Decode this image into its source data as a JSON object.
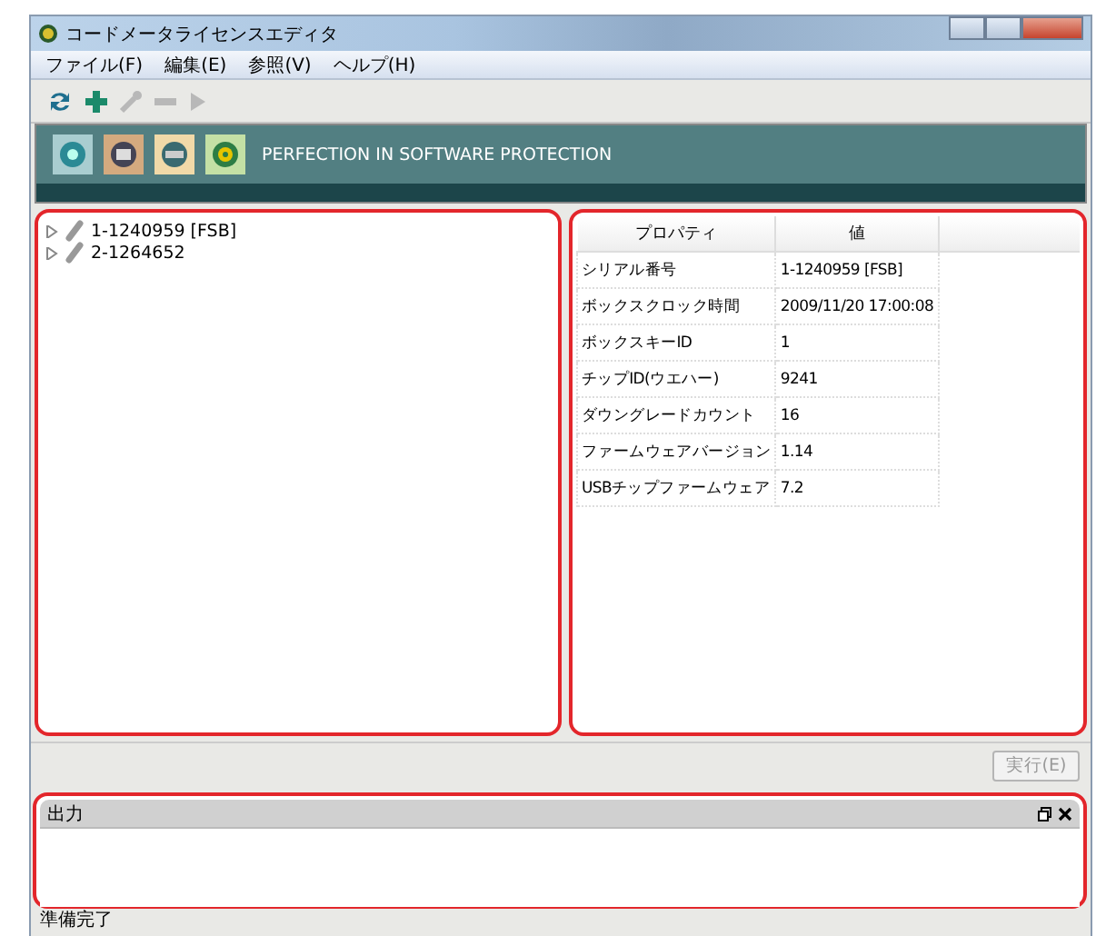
{
  "window": {
    "title": "コードメータライセンスエディタ"
  },
  "menu": [
    "ファイル(F)",
    "編集(E)",
    "参照(V)",
    "ヘルプ(H)"
  ],
  "toolbar": [
    {
      "kind": "refresh",
      "disabled": false
    },
    {
      "kind": "add",
      "disabled": false
    },
    {
      "kind": "wrench",
      "disabled": true
    },
    {
      "kind": "remove",
      "disabled": true
    },
    {
      "kind": "play",
      "disabled": true
    }
  ],
  "banner": {
    "tagline": "PERFECTION IN SOFTWARE PROTECTION"
  },
  "tree": [
    {
      "label": "1-1240959 [FSB]",
      "expanded": false
    },
    {
      "label": "2-1264652",
      "expanded": false
    }
  ],
  "properties": {
    "columns": [
      "プロパティ",
      "値"
    ],
    "rows": [
      {
        "name": "シリアル番号",
        "value": "1-1240959 [FSB]"
      },
      {
        "name": "ボックスクロック時間",
        "value": "2009/11/20 17:00:08"
      },
      {
        "name": "ボックスキーID",
        "value": "1"
      },
      {
        "name": "チップID(ウエハー)",
        "value": "9241"
      },
      {
        "name": "ダウングレードカウント",
        "value": "16"
      },
      {
        "name": "ファームウェアバージョン",
        "value": "1.14"
      },
      {
        "name": "USBチップファームウェア",
        "value": "7.2"
      }
    ]
  },
  "execute_button": {
    "label": "実行(E)",
    "disabled": true
  },
  "output": {
    "title": "出力"
  },
  "status_bar": "準備完了"
}
